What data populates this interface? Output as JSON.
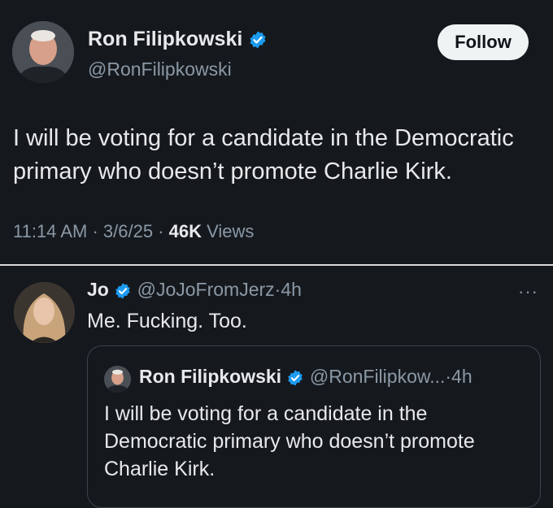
{
  "colors": {
    "background": "#15191e",
    "verified": "#1d9bf0",
    "follow_bg": "#eff3f4"
  },
  "main_tweet": {
    "author_name": "Ron Filipkowski",
    "handle": "@RonFilipkowski",
    "follow_label": "Follow",
    "text": "I will be voting for a candidate in the Democratic primary who doesn’t promote Charlie Kirk.",
    "time": "11:14 AM",
    "sep1": "·",
    "date": "3/6/25",
    "sep2": "·",
    "views_count": "46K",
    "views_label": "Views",
    "icons": {
      "avatar": "profile-photo",
      "badge": "verified-badge-icon"
    }
  },
  "reply": {
    "author_name": "Jo",
    "handle": "@JoJoFromJerz",
    "sep": "·",
    "time": "4h",
    "more": "···",
    "text": "Me. Fucking. Too.",
    "quoted": {
      "author_name": "Ron Filipkowski",
      "handle": "@RonFilipkow...",
      "sep": "·",
      "time": "4h",
      "text": "I will be voting for a candidate in the Democratic primary who doesn’t promote Charlie Kirk."
    }
  }
}
